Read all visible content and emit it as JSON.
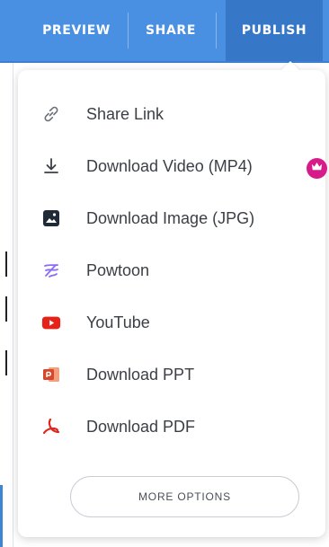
{
  "toolbar": {
    "tabs": [
      {
        "label": "PREVIEW"
      },
      {
        "label": "SHARE"
      },
      {
        "label": "PUBLISH",
        "active": true
      }
    ]
  },
  "publish_menu": {
    "items": [
      {
        "label": "Share Link",
        "icon": "link-icon"
      },
      {
        "label": "Download Video (MP4)",
        "icon": "download-icon",
        "premium": true
      },
      {
        "label": "Download Image (JPG)",
        "icon": "image-icon"
      },
      {
        "label": "Powtoon",
        "icon": "powtoon-icon"
      },
      {
        "label": "YouTube",
        "icon": "youtube-icon"
      },
      {
        "label": "Download PPT",
        "icon": "powerpoint-icon"
      },
      {
        "label": "Download PDF",
        "icon": "pdf-icon"
      }
    ],
    "premium_badge_icon": "crown-icon",
    "more_options_label": "MORE OPTIONS"
  },
  "colors": {
    "toolbar_blue": "#4a90e2",
    "active_tab_blue": "#3677c8",
    "premium_pink": "#d81b8a",
    "youtube_red": "#e62117",
    "pdf_red": "#e0261b",
    "ppt_orange": "#d9472b",
    "powtoon_purple": "#8c6cf0"
  }
}
